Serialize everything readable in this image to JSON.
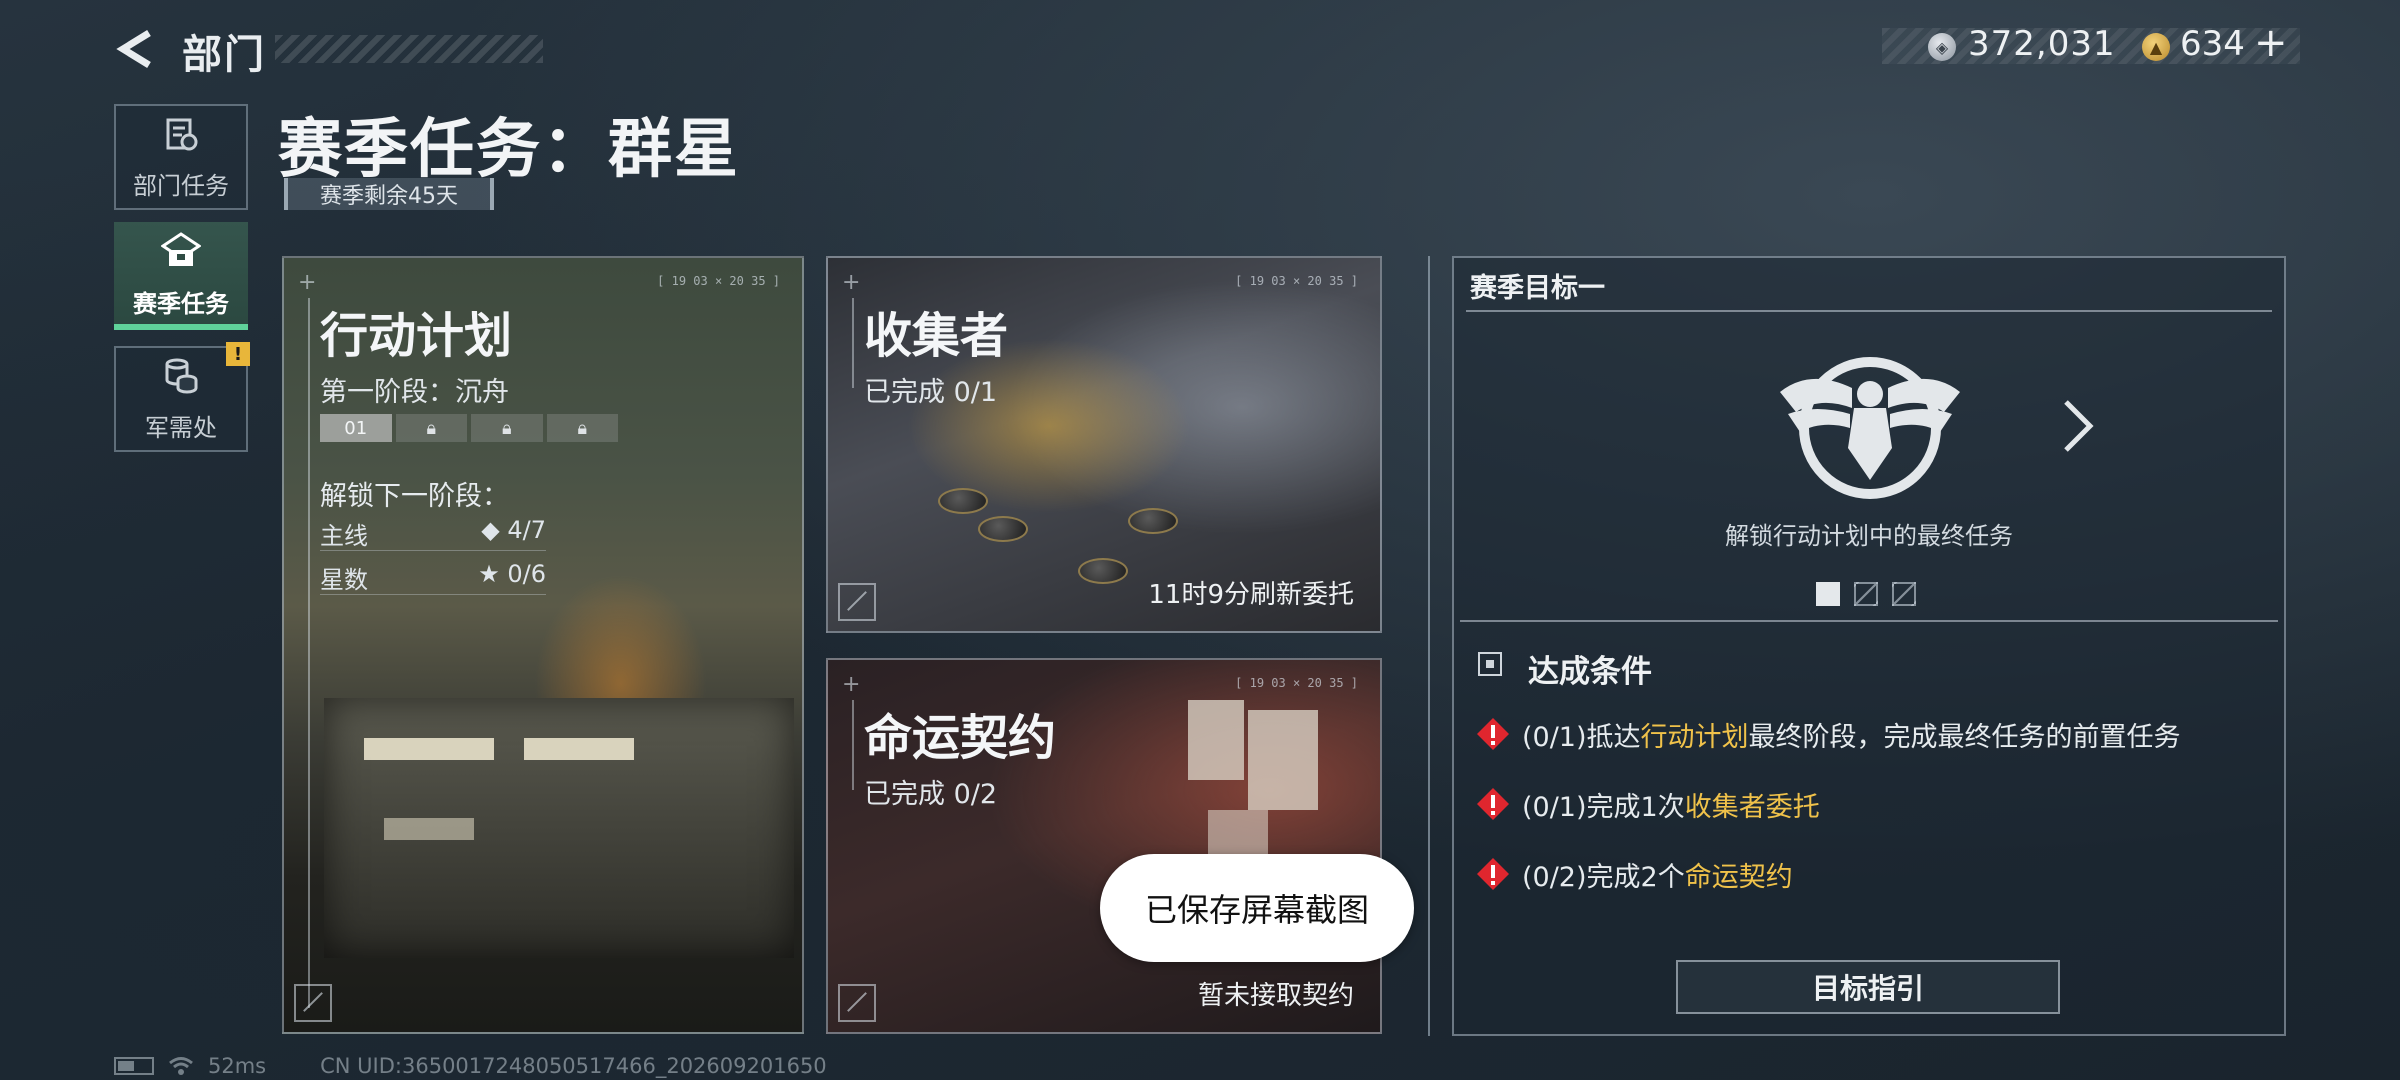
{
  "header": {
    "title": "部门",
    "currency_silver": "372,031",
    "currency_gold": "634",
    "plus_label": "+"
  },
  "nav": [
    {
      "label": "部门任务",
      "icon": "dept-task-icon"
    },
    {
      "label": "赛季任务",
      "icon": "season-task-icon",
      "active": true
    },
    {
      "label": "军需处",
      "icon": "supply-icon",
      "badge": "!"
    }
  ],
  "page": {
    "title": "赛季任务：群星",
    "season_remaining": "赛季剩余45天"
  },
  "cards": {
    "operation": {
      "stamp": "[ 19 03  ×  20 35 ]",
      "title": "行动计划",
      "stage": "第一阶段：沉舟",
      "stages": [
        "01",
        "",
        "",
        ""
      ],
      "unlock_next": "解锁下一阶段：",
      "main_label": "主线",
      "main_value": "◆ 4/7",
      "stars_label": "星数",
      "stars_value": "★ 0/6"
    },
    "collector": {
      "stamp": "[ 19 03  ×  20 35 ]",
      "title": "收集者",
      "progress": "已完成 0/1",
      "footer": "11时9分刷新委托"
    },
    "fate": {
      "stamp": "[ 19 03  ×  20 35 ]",
      "title": "命运契约",
      "progress": "已完成 0/2",
      "footer": "暂未接取契约"
    }
  },
  "goal": {
    "header": "赛季目标一",
    "caption": "解锁行动计划中的最终任务",
    "conditions_title": "达成条件",
    "requirements": [
      {
        "prefix": "(0/1)抵达",
        "highlight": "行动计划",
        "suffix": "最终阶段，完成最终任务的前置任务"
      },
      {
        "prefix": "(0/1)完成1次",
        "highlight": "收集者委托",
        "suffix": ""
      },
      {
        "prefix": "(0/2)完成2个",
        "highlight": "命运契约",
        "suffix": ""
      }
    ],
    "guide_button": "目标指引"
  },
  "toast": "已保存屏幕截图",
  "status": {
    "ping": "52ms",
    "uid": "CN UID:3650017248050517466_202609201650"
  },
  "colors": {
    "accent_green": "#5fd39a",
    "highlight_gold": "#f0c24a",
    "warning_red": "#e0262e",
    "badge_yellow": "#e8b63a"
  }
}
